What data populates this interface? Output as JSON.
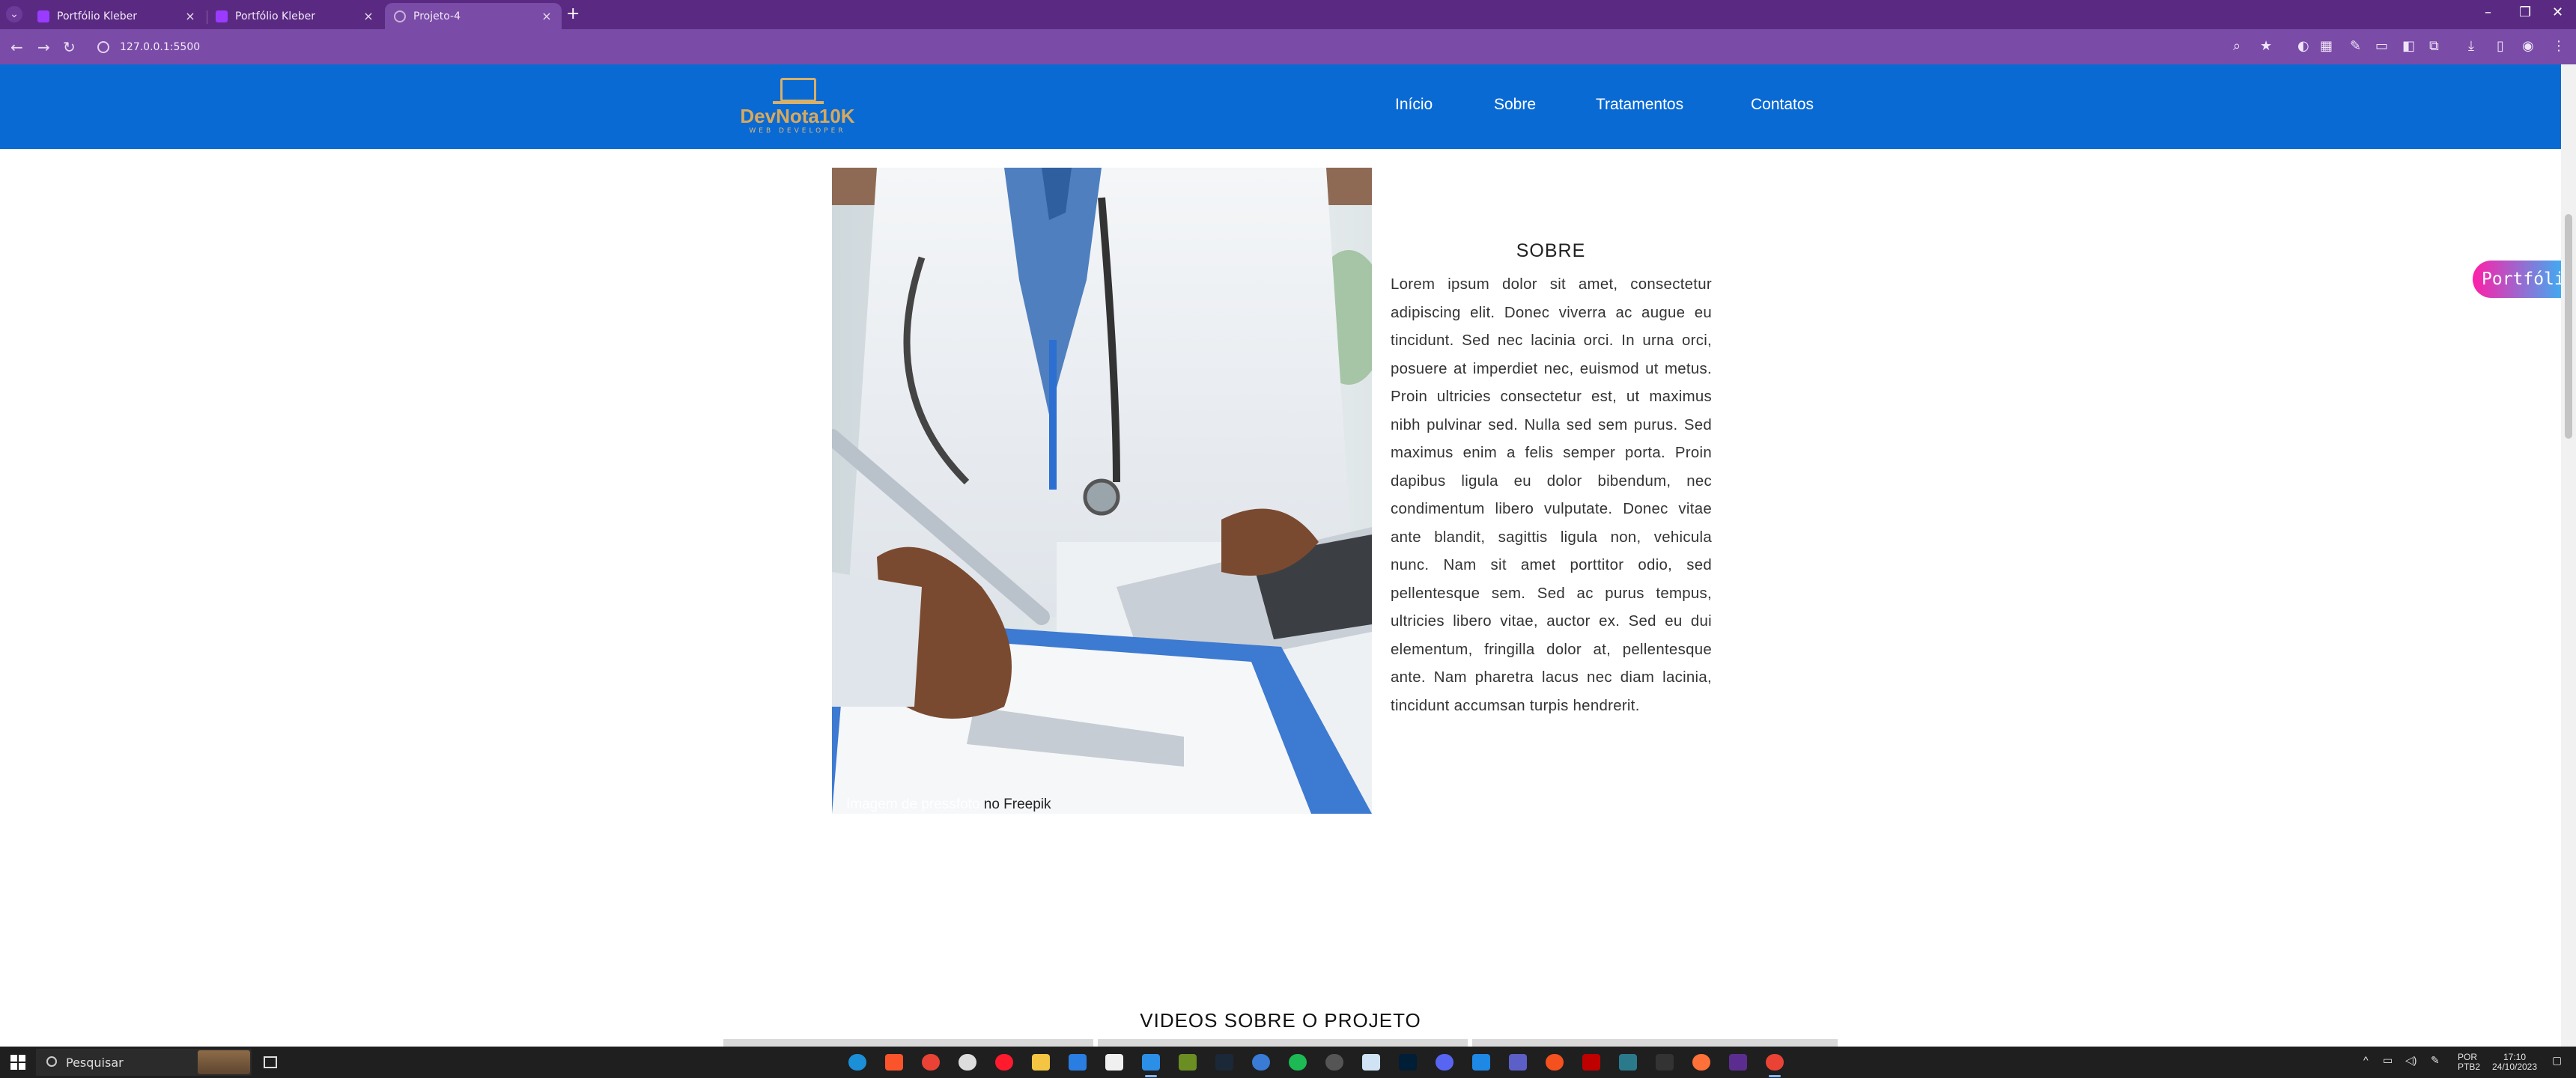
{
  "browser": {
    "tabs": [
      {
        "title": "Portfólio Kleber",
        "favicon": "portfolio-favicon",
        "active": false
      },
      {
        "title": "Portfólio Kleber",
        "favicon": "portfolio-favicon",
        "active": false
      },
      {
        "title": "Projeto-4",
        "favicon": "globe-icon",
        "active": true
      }
    ],
    "new_tab_label": "+",
    "address": "127.0.0.1:5500",
    "accent": "#5a2a82",
    "toolbar_color": "#7a4ba7"
  },
  "site": {
    "header_color": "#0a6ad4",
    "logo": {
      "name": "DevNota10K",
      "tagline": "WEB DEVELOPER"
    },
    "nav": [
      "Início",
      "Sobre",
      "Tratamentos",
      "Contatos"
    ],
    "about": {
      "title": "SOBRE",
      "text": "Lorem ipsum dolor sit amet, consectetur adipiscing elit. Donec viverra ac augue eu tincidunt. Sed nec lacinia orci. In urna orci, posuere at imperdiet nec, euismod ut metus. Proin ultricies consectetur est, ut maximus nibh pulvinar sed. Nulla sed sem purus. Sed maximus enim a felis semper porta. Proin dapibus ligula eu dolor bibendum, nec condimentum libero vulputate. Donec vitae ante blandit, sagittis ligula non, vehicula nunc. Nam sit amet porttitor odio, sed pellentesque sem. Sed ac purus tempus, ultricies libero vitae, auctor ex. Sed eu dui elementum, fringilla dolor at, pellentesque ante. Nam pharetra lacus nec diam lacinia, tincidunt accumsan turpis hendrerit.",
      "photo_credit_link": "Imagem de pressfoto",
      "photo_credit_rest": " no Freepik"
    },
    "portfolio_pill": "Portfólio",
    "videos_title": "VIDEOS SOBRE O PROJETO"
  },
  "taskbar": {
    "search_placeholder": "Pesquisar",
    "lang_1": "POR",
    "lang_2": "PTB2",
    "time": "17:10",
    "date": "24/10/2023"
  }
}
